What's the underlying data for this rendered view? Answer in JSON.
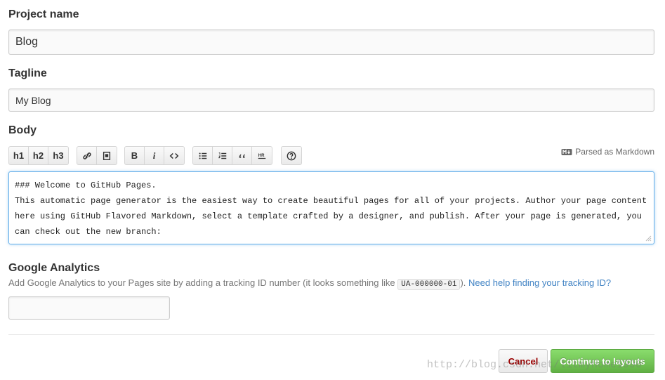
{
  "project_name": {
    "label": "Project name",
    "value": "Blog"
  },
  "tagline": {
    "label": "Tagline",
    "value": "My Blog"
  },
  "body": {
    "label": "Body",
    "toolbar": {
      "h1": "h1",
      "h2": "h2",
      "h3": "h3",
      "bold": "B",
      "italic": "i"
    },
    "markdown_note": "Parsed as Markdown",
    "content": "### Welcome to GitHub Pages.\nThis automatic page generator is the easiest way to create beautiful pages for all of your projects. Author your page content\nhere using GitHub Flavored Markdown, select a template crafted by a designer, and publish. After your page is generated, you\ncan check out the new branch:"
  },
  "analytics": {
    "label": "Google Analytics",
    "desc_prefix": "Add Google Analytics to your Pages site by adding a tracking ID number (it looks something like",
    "example_id": "UA-000000-01",
    "desc_suffix": ").",
    "help_link": "Need help finding your tracking ID?",
    "value": ""
  },
  "actions": {
    "cancel": "Cancel",
    "continue": "Continue to layouts"
  },
  "watermark": "http://blog.csdn.net/litmyhome1990"
}
